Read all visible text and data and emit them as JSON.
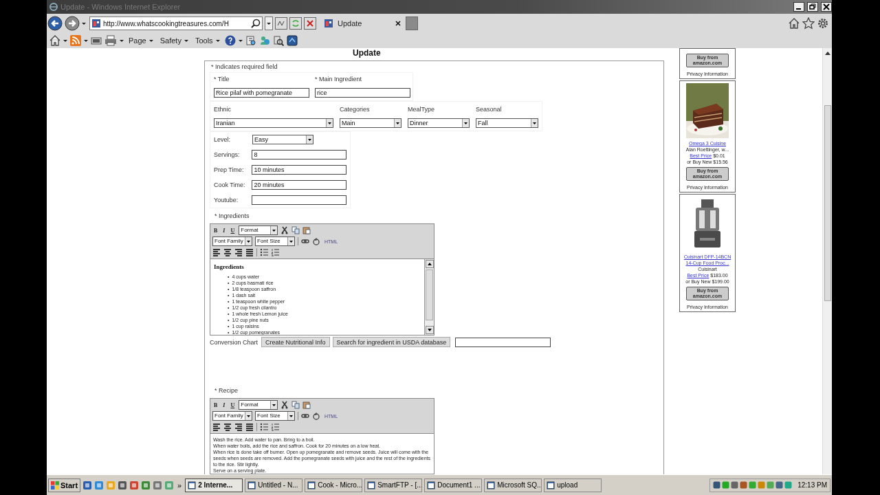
{
  "browser": {
    "title": "Update - Windows Internet Explorer",
    "address": "http://www.whatscookingtreasures.com/H",
    "tab": "Update",
    "menus": [
      "Page",
      "Safety",
      "Tools"
    ]
  },
  "page": {
    "heading": "Update",
    "required_note": "* Indicates required field",
    "top_fields": [
      {
        "label": "* Title",
        "value": "Rice pilaf with pomegranate"
      },
      {
        "label": "* Main Ingredient",
        "value": "rice"
      }
    ],
    "selects": [
      {
        "label": "Ethnic",
        "value": "Iranian"
      },
      {
        "label": "Categories",
        "value": "Main"
      },
      {
        "label": "MealType",
        "value": "Dinner"
      },
      {
        "label": "Seasonal",
        "value": "Fall"
      }
    ],
    "details": [
      {
        "label": "Level:",
        "kind": "select",
        "value": "Easy"
      },
      {
        "label": "Servings:",
        "kind": "text",
        "value": "8"
      },
      {
        "label": "Prep Time:",
        "kind": "text",
        "value": "10 minutes"
      },
      {
        "label": "Cook Time:",
        "kind": "text",
        "value": "20 minutes"
      },
      {
        "label": "Youtube:",
        "kind": "text"
      }
    ],
    "editors": [
      {
        "label": "* Ingredients",
        "kind": "list",
        "toolbar": {
          "bold": "B",
          "italic": "I",
          "underline": "U",
          "format": "Format",
          "font_family": "Font Family",
          "font_size": "Font Size",
          "html": "HTML"
        },
        "heading": "Ingredients",
        "bullet": "•",
        "items": [
          "4 cups water",
          "2 cups basmati rice",
          "1/8 teaspoon saffron",
          "1 dash salt",
          "1 teaspoon white pepper",
          "1/2 cup fresh cilantro",
          "1 whole fresh Lemon juice",
          "1/2 cup pine nuts",
          "1 cup raisins",
          "1/2 cup pomegranates"
        ],
        "after": {
          "link": "Conversion Chart",
          "buttons": [
            "Create Nutritional Info",
            "Search for ingredient in USDA database"
          ]
        }
      },
      {
        "label": "* Recipe",
        "kind": "text",
        "toolbar": {
          "bold": "B",
          "italic": "I",
          "underline": "U",
          "format": "Format",
          "font_family": "Font Family",
          "font_size": "Font Size",
          "html": "HTML"
        },
        "lines": [
          "Wash the rice. Add water to pan. Bring to a boil.",
          "When water boils, add the rice and saffron. Cook for 20 minutes on a low heat.",
          "When rice is done take off burner. Open up pomegranate and remove seeds. Juice will come with the seeds when seeds are removed. Add the pomegranate seeds with juice and the rest of the ingredients to the rice. Stir lightly.",
          "Serve on a serving plate."
        ]
      }
    ]
  },
  "ads": [
    {
      "kind": "partial",
      "button": "Buy from amazon.com",
      "privacy": "Privacy Information"
    },
    {
      "kind": "product",
      "title": "Omega 3 Cuisine",
      "maker": "Alan Roettinger, w...",
      "best_price_link": "Best Price",
      "best_price": "$0.01",
      "buy_new": "or Buy New $15.56",
      "button": "Buy from amazon.com",
      "privacy": "Privacy Information"
    },
    {
      "kind": "product",
      "title": "Cuisinart DFP-14BCN 14-Cup Food Proc...",
      "maker": "Cuisinart",
      "best_price_link": "Best Price",
      "best_price": "$183.00",
      "buy_new": "or Buy New $199.00",
      "button": "Buy from amazon.com",
      "privacy": "Privacy Information"
    }
  ],
  "taskbar": {
    "start": "Start",
    "more": "»",
    "tasks": [
      {
        "label": "2 Interne...",
        "selected": true
      },
      {
        "label": "Untitled - N...",
        "selected": false
      },
      {
        "label": "Cook - Micro...",
        "selected": false
      },
      {
        "label": "SmartFTP - [...",
        "selected": false
      },
      {
        "label": "Document1 ...",
        "selected": false
      },
      {
        "label": "Microsoft SQ...",
        "selected": false
      },
      {
        "label": "upload",
        "selected": false
      }
    ],
    "clock": "12:13 PM"
  }
}
